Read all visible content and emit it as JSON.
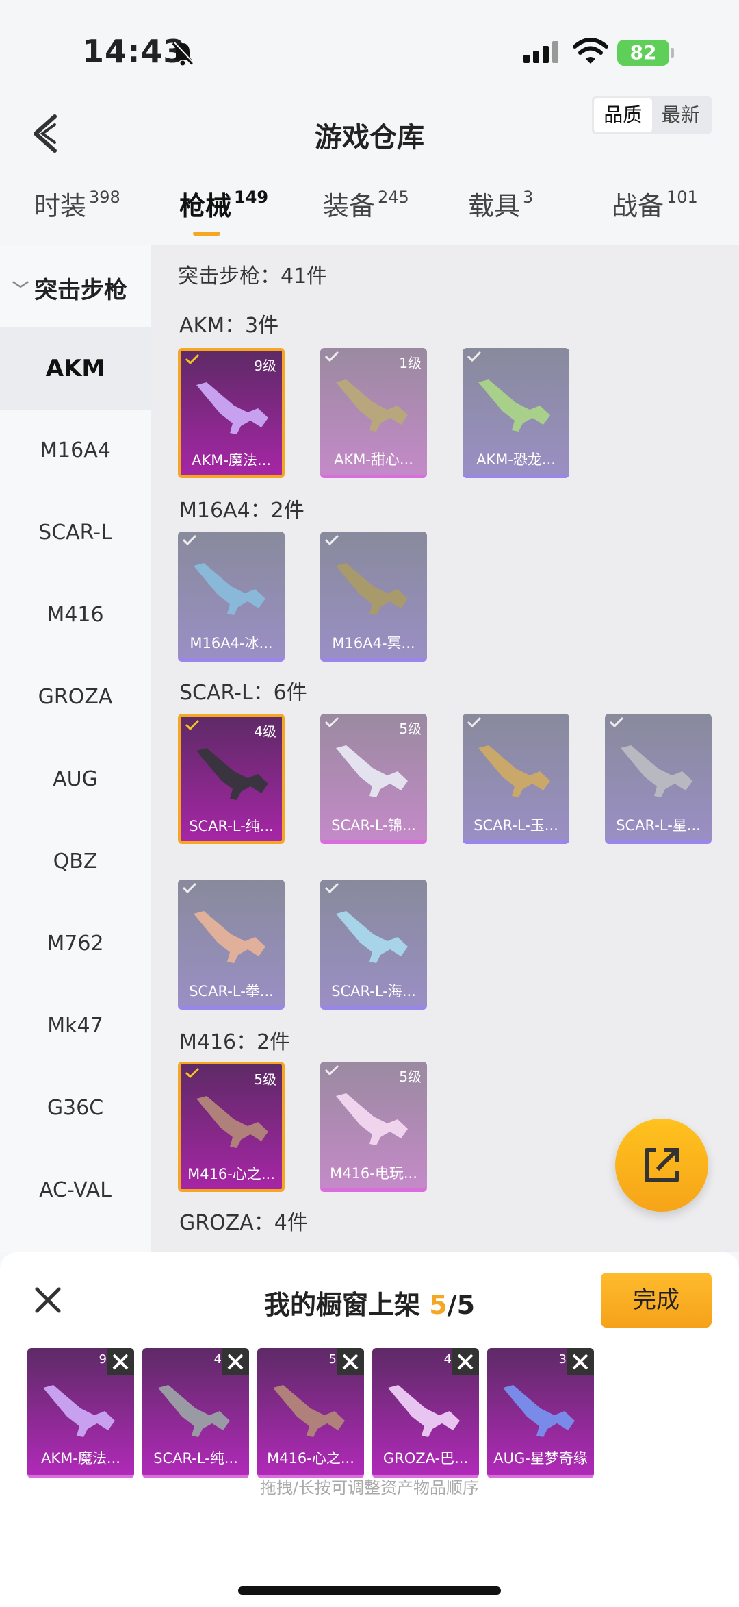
{
  "status": {
    "time": "14:43",
    "battery": "82"
  },
  "header": {
    "title": "游戏仓库",
    "sort_quality": "品质",
    "sort_newest": "最新"
  },
  "tabs": [
    {
      "label": "时装",
      "count": "398"
    },
    {
      "label": "枪械",
      "count": "149"
    },
    {
      "label": "装备",
      "count": "245"
    },
    {
      "label": "载具",
      "count": "3"
    },
    {
      "label": "战备",
      "count": "101"
    }
  ],
  "sidebar": {
    "category": "突击步枪",
    "items": [
      "AKM",
      "M16A4",
      "SCAR-L",
      "M416",
      "GROZA",
      "AUG",
      "QBZ",
      "M762",
      "Mk47",
      "G36C",
      "AC-VAL"
    ]
  },
  "content": {
    "category_count": "突击步枪：41件",
    "sections": [
      {
        "title": "AKM：3件",
        "cards": [
          {
            "name": "AKM-魔法...",
            "level": "9级",
            "rarity": "gold"
          },
          {
            "name": "AKM-甜心...",
            "level": "1级",
            "rarity": "pink"
          },
          {
            "name": "AKM-恐龙...",
            "level": "",
            "rarity": "purple"
          }
        ]
      },
      {
        "title": "M16A4：2件",
        "cards": [
          {
            "name": "M16A4-冰...",
            "level": "",
            "rarity": "purple"
          },
          {
            "name": "M16A4-冥...",
            "level": "",
            "rarity": "purple"
          }
        ]
      },
      {
        "title": "SCAR-L：6件",
        "cards": [
          {
            "name": "SCAR-L-纯...",
            "level": "4级",
            "rarity": "gold"
          },
          {
            "name": "SCAR-L-锦...",
            "level": "5级",
            "rarity": "pink"
          },
          {
            "name": "SCAR-L-玉...",
            "level": "",
            "rarity": "purple"
          },
          {
            "name": "SCAR-L-星...",
            "level": "",
            "rarity": "purple"
          },
          {
            "name": "SCAR-L-拳...",
            "level": "",
            "rarity": "purple"
          },
          {
            "name": "SCAR-L-海...",
            "level": "",
            "rarity": "purple"
          }
        ]
      },
      {
        "title": "M416：2件",
        "cards": [
          {
            "name": "M416-心之...",
            "level": "5级",
            "rarity": "gold"
          },
          {
            "name": "M416-电玩...",
            "level": "5级",
            "rarity": "pink"
          }
        ]
      },
      {
        "title": "GROZA：4件"
      }
    ]
  },
  "sheet": {
    "title": "我的橱窗上架",
    "count": "5",
    "total": "/5",
    "done_label": "完成",
    "hint": "拖拽/长按可调整资产物品顺序",
    "items": [
      {
        "name": "AKM-魔法...",
        "level": "9"
      },
      {
        "name": "SCAR-L-纯...",
        "level": "4"
      },
      {
        "name": "M416-心之...",
        "level": "5"
      },
      {
        "name": "GROZA-巴...",
        "level": "4"
      },
      {
        "name": "AUG-星梦奇缘",
        "level": "3"
      }
    ]
  },
  "colors": {
    "accent": "#f5a623",
    "gold_card": "#a626a6",
    "pink_card": "#c48ac8",
    "purple_card": "#9a8fc4"
  }
}
